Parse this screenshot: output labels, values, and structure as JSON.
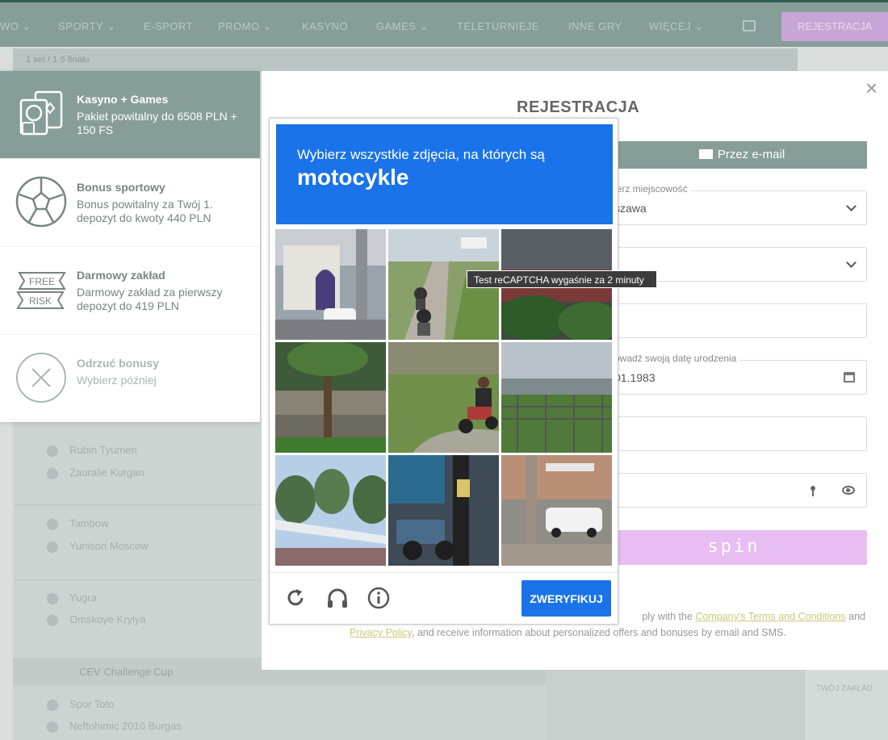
{
  "nav": {
    "items": [
      "WO ⌄",
      "SPORTY ⌄",
      "E-SPORT",
      "PROMO ⌄",
      "KASYNO",
      "GAMES ⌄",
      "TELETURNIEJE",
      "INNE GRY",
      "WIĘCEJ ⌄"
    ],
    "register_label": "REJESTRACJA"
  },
  "subbar": {
    "text": "1 set / 1-5 finału"
  },
  "background_rows": [
    "Rubin Tyumen",
    "Zauralie Kurgan",
    "Tambow",
    "Yunison Moscow",
    "Yugra",
    "Omskoye Krylya"
  ],
  "background_cup": "CEV Challenge Cup",
  "background_rows2": [
    "Spor Toto",
    "Neftohimic 2010 Burgas"
  ],
  "background_right": "TWÓJ ZAKŁAD",
  "bonuses": [
    {
      "title": "Kasyno + Games",
      "desc": "Pakiet powitalny do 6508 PLN + 150 FS",
      "icon": "casino-cards-icon"
    },
    {
      "title": "Bonus sportowy",
      "desc": "Bonus powitalny za Twój 1. depozyt do kwoty 440 PLN",
      "icon": "soccer-ball-icon"
    },
    {
      "title": "Darmowy zakład",
      "desc": "Darmowy zakład za pierwszy depozyt do 419 PLN",
      "icon": "free-risk-icon",
      "badge_top": "FREE",
      "badge_bottom": "RISK"
    },
    {
      "title": "Odrzuć bonusy",
      "desc": "Wybierz później",
      "icon": "decline-x-icon"
    }
  ],
  "modal": {
    "close": "×",
    "title": "REJESTRACJA",
    "email_tab": "Przez e-mail",
    "city_label": "ierz miejscowość",
    "city_value": "szawa",
    "dob_label": "owadź swoją datę urodzenia",
    "dob_value": "01.1983",
    "spin_label": "spin",
    "terms_pre": "ply with the ",
    "terms_link1": "Company's Terms and Conditions",
    "terms_mid": " and",
    "terms_link2": "Privacy Policy",
    "terms_post": ", and receive information about personalized offers and bonuses by email and SMS."
  },
  "captcha": {
    "prompt": "Wybierz wszystkie zdjęcia, na których są",
    "target": "motocykle",
    "verify_label": "ZWERYFIKUJ",
    "tooltip": "Test reCAPTCHA wygaśnie za 2 minuty",
    "tiles": [
      "building",
      "road-motorbikes",
      "dark-garden",
      "tree-road",
      "rider-grass",
      "fence-field",
      "trees-sky",
      "market-bike",
      "street-car"
    ]
  },
  "colors": {
    "accent": "#879d98",
    "captcha_blue": "#1a73e8",
    "spin_pink": "#e8bdf2",
    "terms_link": "#c9c97a"
  }
}
